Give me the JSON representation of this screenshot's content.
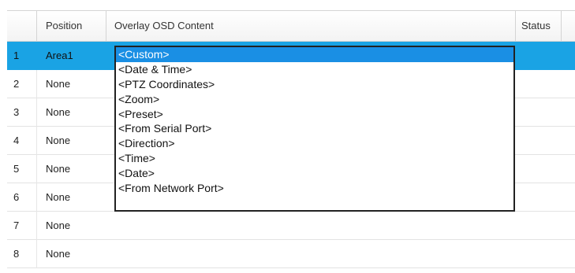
{
  "table": {
    "columns": {
      "position": "Position",
      "content": "Overlay OSD Content",
      "status": "Status"
    },
    "rows": [
      {
        "index": "1",
        "position": "Area1",
        "selected": true
      },
      {
        "index": "2",
        "position": "None"
      },
      {
        "index": "3",
        "position": "None"
      },
      {
        "index": "4",
        "position": "None"
      },
      {
        "index": "5",
        "position": "None"
      },
      {
        "index": "6",
        "position": "None"
      },
      {
        "index": "7",
        "position": "None"
      },
      {
        "index": "8",
        "position": "None"
      }
    ]
  },
  "dropdown": {
    "selected": "<Custom>",
    "options": [
      "<Custom>",
      "<Date & Time>",
      "<PTZ Coordinates>",
      "<Zoom>",
      "<Preset>",
      "<From Serial Port>",
      "<Direction>",
      "<Time>",
      "<Date>",
      "<From Network Port>"
    ]
  },
  "colors": {
    "selected_row": "#1aa3e4",
    "highlight_option": "#1a8fe4"
  }
}
